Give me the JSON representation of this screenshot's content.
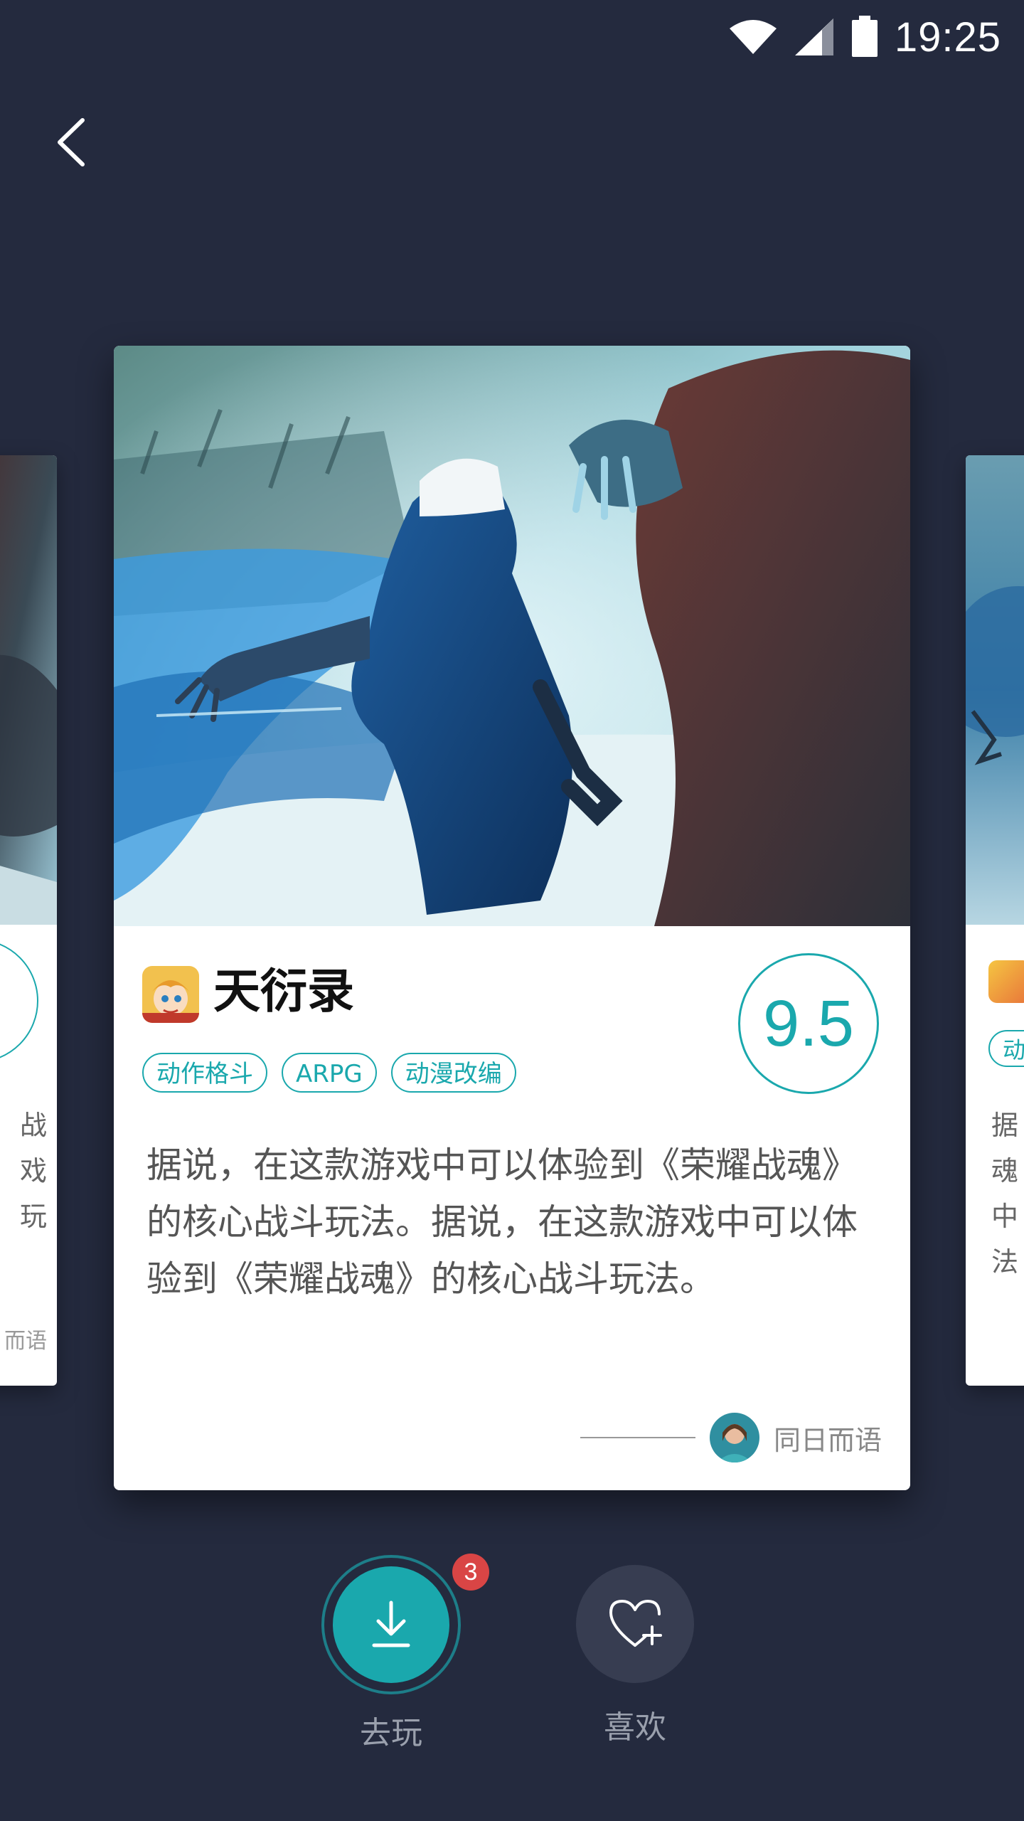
{
  "status_bar": {
    "time": "19:25",
    "icons": [
      "wifi-icon",
      "signal-icon",
      "battery-icon"
    ]
  },
  "navigation": {
    "back_icon": "chevron-left-icon"
  },
  "main_card": {
    "title": "天衍录",
    "score": "9.5",
    "tags": [
      "动作格斗",
      "ARPG",
      "动漫改编"
    ],
    "description": "据说，在这款游戏中可以体验到《荣耀战魂》的核心战斗玩法。据说，在这款游戏中可以体验到《荣耀战魂》的核心战斗玩法。",
    "author": "同日而语"
  },
  "side_cards": {
    "left": {
      "lines": [
        "战",
        "戏",
        "玩"
      ],
      "author": "而语"
    },
    "right": {
      "tag": "动",
      "lines": [
        "据",
        "魂",
        "中",
        "法"
      ]
    }
  },
  "actions": {
    "play_label": "去玩",
    "play_badge": "3",
    "like_label": "喜欢"
  },
  "colors": {
    "background": "#242a3e",
    "accent": "#1aa8ad",
    "badge": "#d94545"
  }
}
